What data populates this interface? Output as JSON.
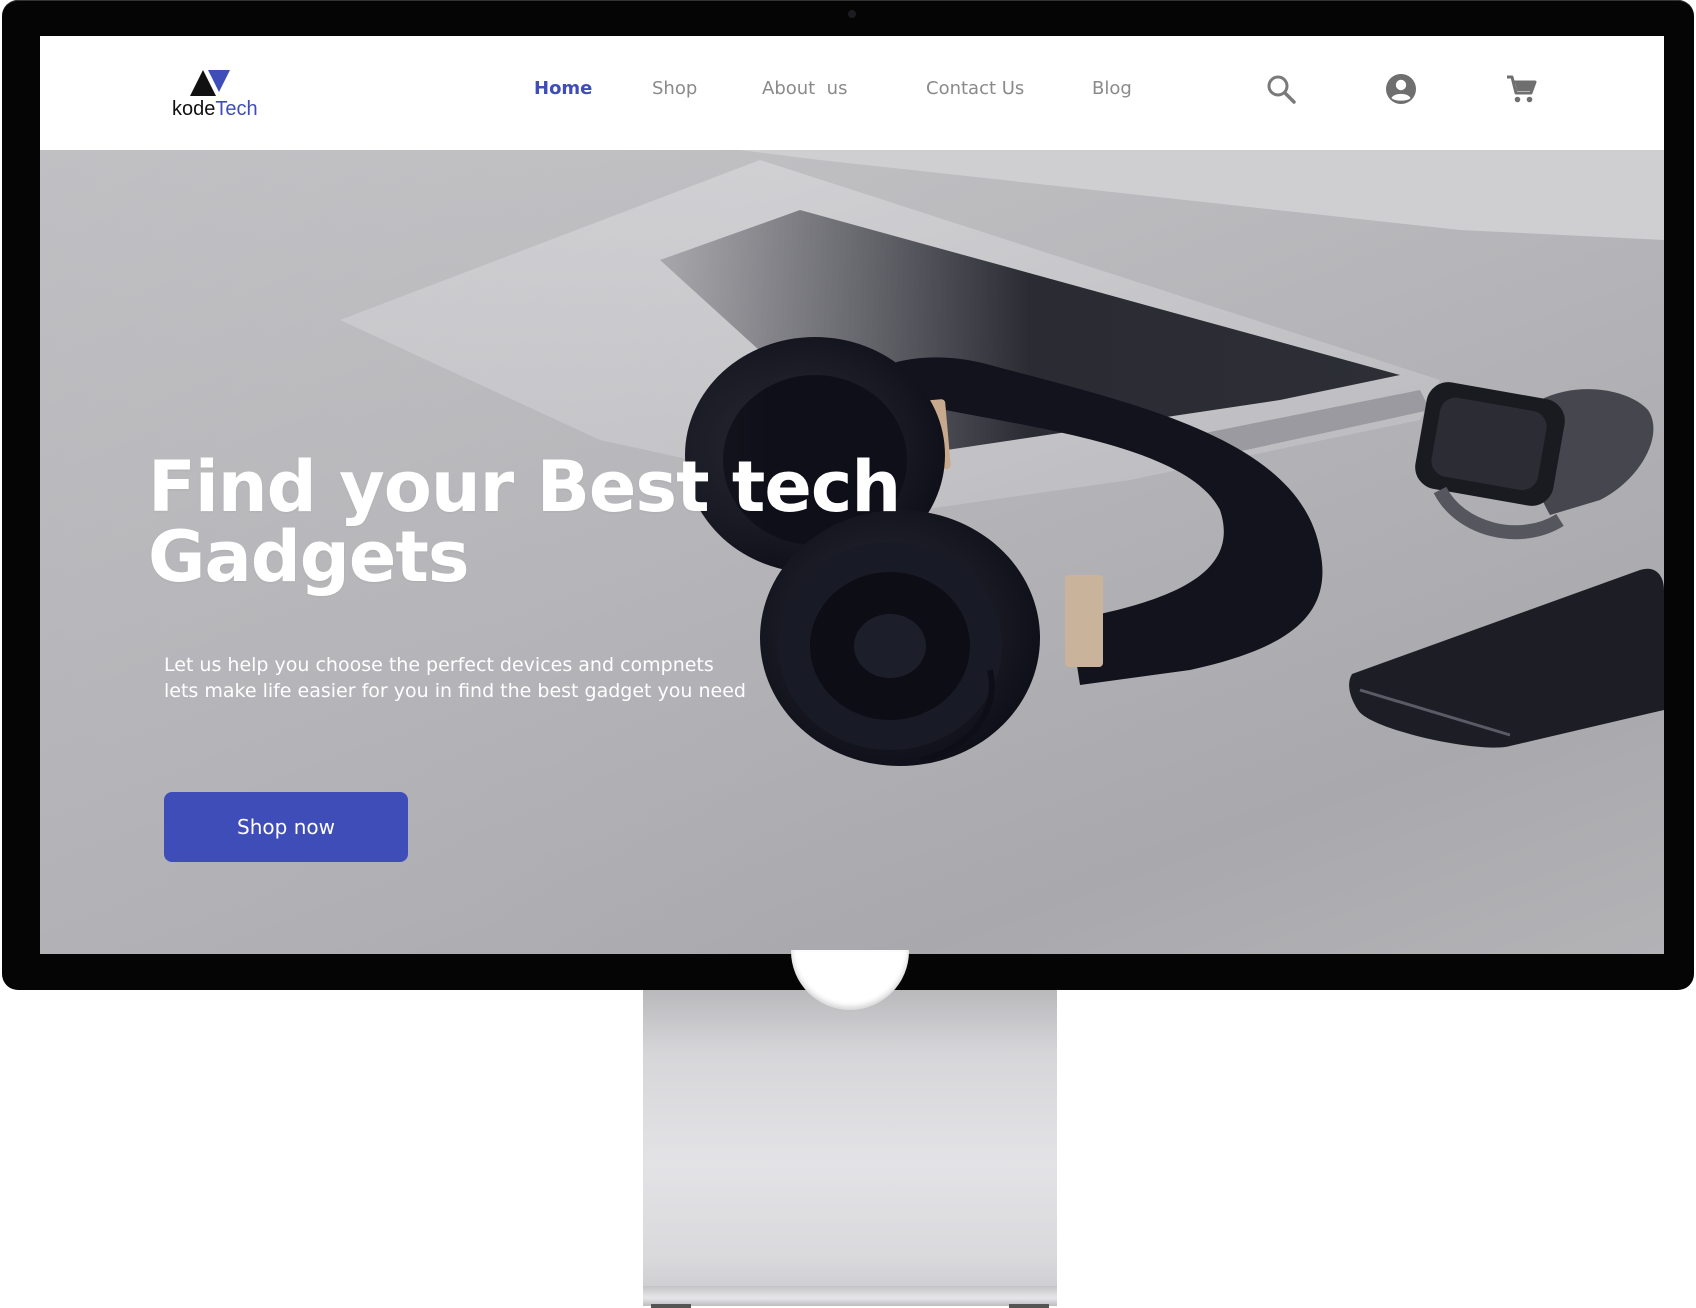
{
  "brand": {
    "name_part1": "kode",
    "name_part2": "Tech",
    "accent_color": "#3f4db8"
  },
  "nav": {
    "links": [
      {
        "label": "Home",
        "active": true
      },
      {
        "label": "Shop",
        "active": false
      },
      {
        "label": "About  us",
        "active": false
      },
      {
        "label": "Contact Us",
        "active": false
      },
      {
        "label": "Blog",
        "active": false
      }
    ],
    "icons": [
      "search-icon",
      "account-icon",
      "cart-icon"
    ]
  },
  "hero": {
    "title_line1": "Find your Best tech",
    "title_line2": "Gadgets",
    "subtitle_line1": "Let us help you choose the perfect devices and compnets",
    "subtitle_line2": "lets make life easier for you in find the best gadget you need",
    "cta_label": "Shop now",
    "button_color": "#3f4db8"
  }
}
